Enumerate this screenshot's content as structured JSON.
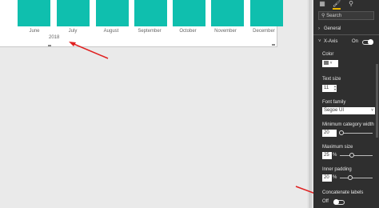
{
  "chart_data": {
    "type": "bar",
    "categories": [
      "June",
      "July",
      "August",
      "September",
      "October",
      "November",
      "December"
    ],
    "x_group_label": "2018",
    "colors": {
      "bar": "#0fbfae"
    }
  },
  "pane": {
    "search_placeholder": "Search",
    "tabs": [
      "fields-icon",
      "format-icon",
      "analytics-icon"
    ],
    "general_label": "General",
    "xaxis": {
      "label": "X-Axis",
      "toggle_state": "On",
      "color_label": "Color",
      "text_size_label": "Text size",
      "text_size_value": "11",
      "font_family_label": "Font family",
      "font_family_value": "Segoe UI",
      "min_category_width_label": "Minimum category width",
      "min_category_width_value": "20",
      "max_size_label": "Maximum size",
      "max_size_value": "25",
      "max_size_unit": "%",
      "inner_padding_label": "Inner padding",
      "inner_padding_value": "20",
      "inner_padding_unit": "%",
      "concatenate_label": "Concatenate labels",
      "concatenate_state": "Off"
    }
  },
  "colors": {
    "pane_bg": "#2f2f2f",
    "accent_tab": "#e8b500",
    "arrow": "#e02020"
  }
}
